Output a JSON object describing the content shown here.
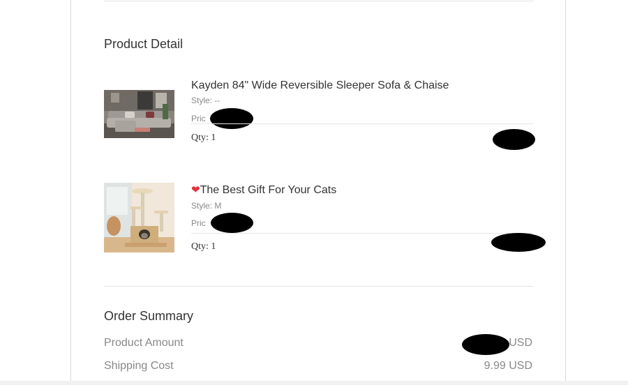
{
  "product_detail": {
    "title": "Product Detail",
    "items": [
      {
        "name": "Kayden 84\" Wide Reversible Sleeper Sofa & Chaise",
        "style": "Style: --",
        "price_label": "Pric",
        "qty": "Qty: 1",
        "thumbnail_icon": "sofa-photo"
      },
      {
        "heart": "❤",
        "name": "The Best Gift For Your Cats",
        "style": "Style: M",
        "price_label": "Pric",
        "qty": "Qty: 1",
        "thumbnail_icon": "cat-tree-photo"
      }
    ]
  },
  "order_summary": {
    "title": "Order Summary",
    "rows": [
      {
        "label": "Product Amount",
        "value": "USD"
      },
      {
        "label": "Shipping Cost",
        "value": "9.99 USD"
      }
    ]
  },
  "colors": {
    "text_primary": "#333333",
    "text_muted": "#888888",
    "divider": "#e6e6e6",
    "heart": "#e0323b",
    "redaction": "#000000"
  }
}
